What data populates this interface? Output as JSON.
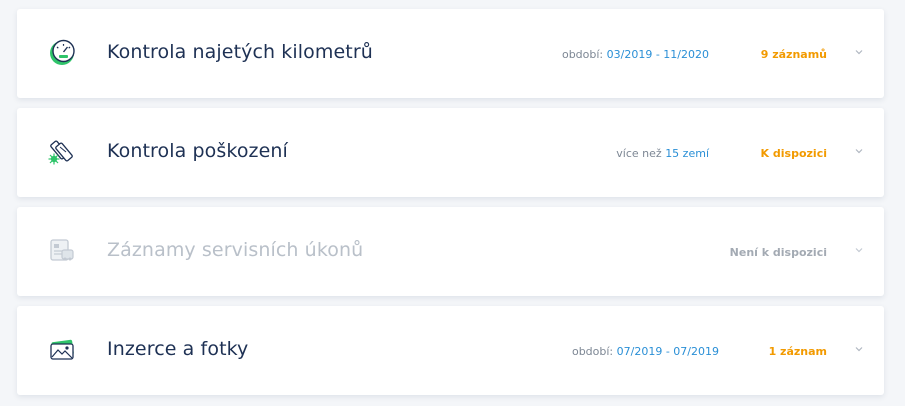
{
  "colors": {
    "title": "#1e3154",
    "title_disabled": "#b9c0c9",
    "accent_blue": "#2a8fd6",
    "accent_orange": "#f29a00",
    "muted": "#7d8794",
    "green": "#2fc46a"
  },
  "sections": [
    {
      "icon": "speedometer-icon",
      "title": "Kontrola najetých kilometrů",
      "meta_prefix": "období: ",
      "meta_value": "03/2019 - 11/2020",
      "status": "9 záznamů"
    },
    {
      "icon": "damage-tools-icon",
      "title": "Kontrola poškození",
      "meta_prefix": "více než ",
      "meta_value": "15 zemí",
      "status": "K dispozici"
    },
    {
      "icon": "service-records-icon",
      "title": "Záznamy servisních úkonů",
      "meta_prefix": "",
      "meta_value": "",
      "status": "Není k dispozici"
    },
    {
      "icon": "photo-ads-icon",
      "title": "Inzerce a fotky",
      "meta_prefix": "období: ",
      "meta_value": "07/2019 - 07/2019",
      "status": "1 záznam"
    }
  ]
}
